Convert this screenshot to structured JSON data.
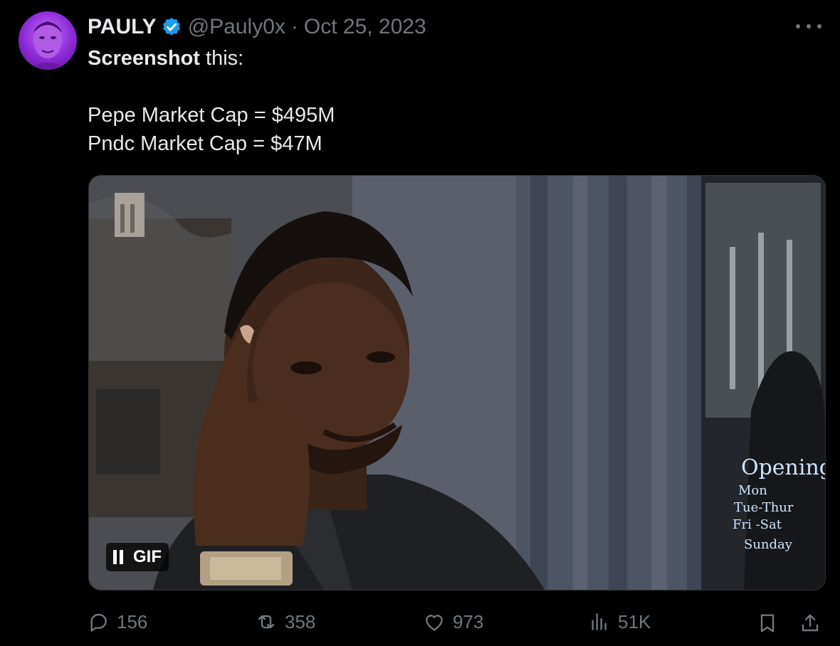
{
  "tweet": {
    "author_name": "PAULY",
    "handle": "@Pauly0x",
    "separator": "·",
    "date": "Oct 25, 2023",
    "text_bold": "Screenshot",
    "text_rest": " this:",
    "lines": [
      "Pepe Market Cap = $495M",
      "Pndc Market Cap = $47M"
    ]
  },
  "media": {
    "badge_label": "GIF",
    "sign_text": [
      "Opening",
      "Mon",
      "Tue-Thur",
      "Fri -Sat",
      "Sunday"
    ]
  },
  "actions": {
    "replies": "156",
    "reposts": "358",
    "likes": "973",
    "views": "51K"
  },
  "icons": {
    "verified": "verified-badge-icon",
    "more": "more-icon",
    "reply": "reply-icon",
    "repost": "repost-icon",
    "like": "heart-icon",
    "views": "views-icon",
    "bookmark": "bookmark-icon",
    "share": "share-icon"
  },
  "colors": {
    "background": "#000000",
    "text": "#e7e9ea",
    "muted": "#71767b",
    "verified": "#1d9bf0"
  }
}
